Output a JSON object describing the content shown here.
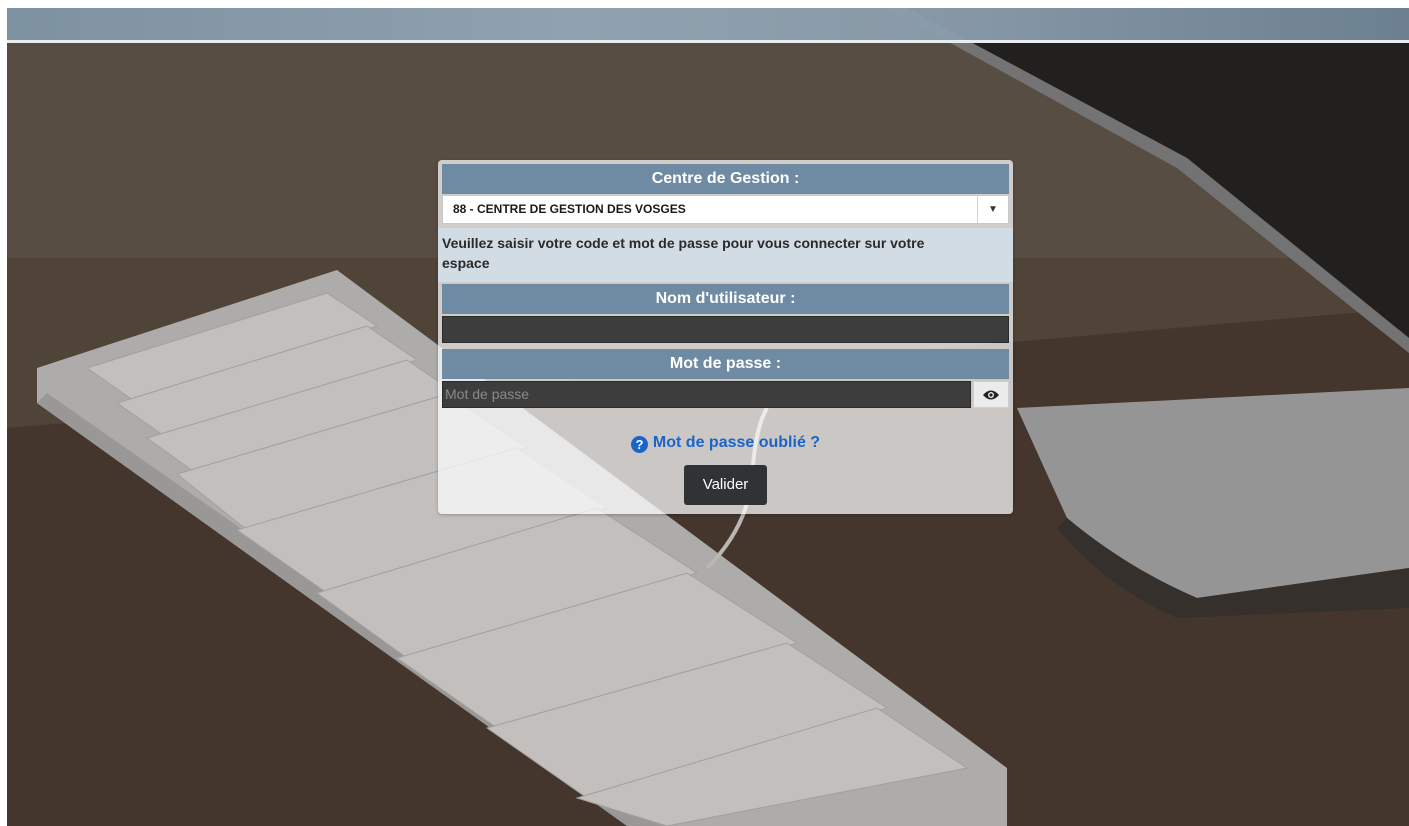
{
  "centre": {
    "header": "Centre de Gestion :",
    "selected": "88 - CENTRE DE GESTION DES VOSGES"
  },
  "instructions": "Veuillez saisir votre code et mot de passe pour vous connecter sur votre espace",
  "username": {
    "header": "Nom d'utilisateur :",
    "value": ""
  },
  "password": {
    "header": "Mot de passe :",
    "placeholder": "Mot de passe"
  },
  "forgot_link": "Mot de passe oublié ?",
  "submit_label": "Valider",
  "icons": {
    "dropdown": "chevron-down-icon",
    "show_password": "eye-icon",
    "help": "question-circle-icon"
  },
  "colors": {
    "header_bg": "#6f8ba3",
    "link": "#1b64c9",
    "button_bg": "#2f3336"
  }
}
